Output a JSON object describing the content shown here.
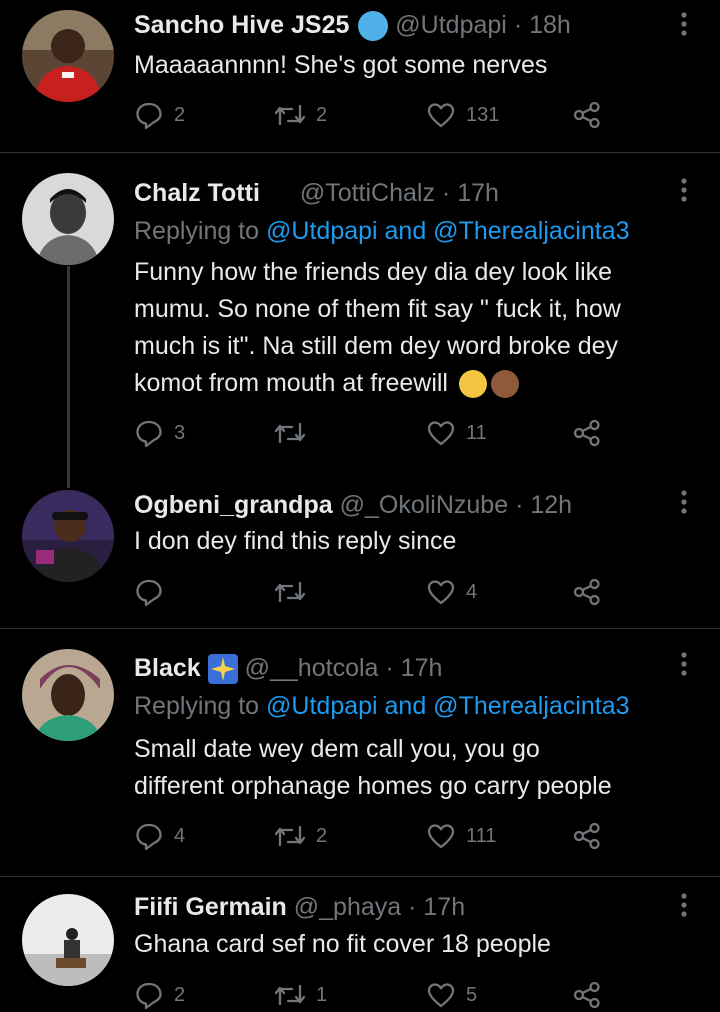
{
  "tweets": [
    {
      "name": "Sancho Hive JS25",
      "handle": "@Utdpapi",
      "sep": "·",
      "time": "18h",
      "text": "Maaaaannnn! She's got some nerves",
      "replies": "2",
      "retweets": "2",
      "likes": "131"
    },
    {
      "name": "Chalz Totti",
      "handle": "@TottiChalz",
      "sep": "·",
      "time": "17h",
      "replying_label": "Replying to",
      "mention_text": "@Utdpapi and @Therealjacinta3",
      "lines": [
        "Funny how the  friends dey dia dey look like",
        "mumu. So none of them fit say \" fuck it, how",
        "much is it\". Na still dem dey word broke dey",
        "komot from mouth at freewill"
      ],
      "replies": "3",
      "retweets": "",
      "likes": "11"
    },
    {
      "name": "Ogbeni_grandpa",
      "handle": "@_OkoliNzube",
      "sep": "·",
      "time": "12h",
      "text": "I don dey find this reply since",
      "replies": "",
      "retweets": "",
      "likes": "4"
    },
    {
      "name": "Black",
      "handle": "@__hotcola",
      "sep": "·",
      "time": "17h",
      "replying_label": "Replying to",
      "mention_text": "@Utdpapi and @Therealjacinta3",
      "lines": [
        "Small date wey dem call you, you go",
        "different orphanage homes go carry people"
      ],
      "replies": "4",
      "retweets": "2",
      "likes": "111"
    },
    {
      "name": "Fiifi Germain",
      "handle": "@_phaya",
      "sep": "·",
      "time": "17h",
      "text": "Ghana card sef no fit cover 18 people",
      "replies": "2",
      "retweets": "1",
      "likes": "5"
    }
  ],
  "icons": {
    "reply": "reply-icon",
    "retweet": "retweet-icon",
    "like": "heart-icon",
    "share": "share-icon",
    "more": "more-options-icon"
  },
  "colors": {
    "background": "#000000",
    "text": "#e7e9ea",
    "muted": "#71767b",
    "link": "#1d9bf0",
    "divider": "#2f3336"
  }
}
